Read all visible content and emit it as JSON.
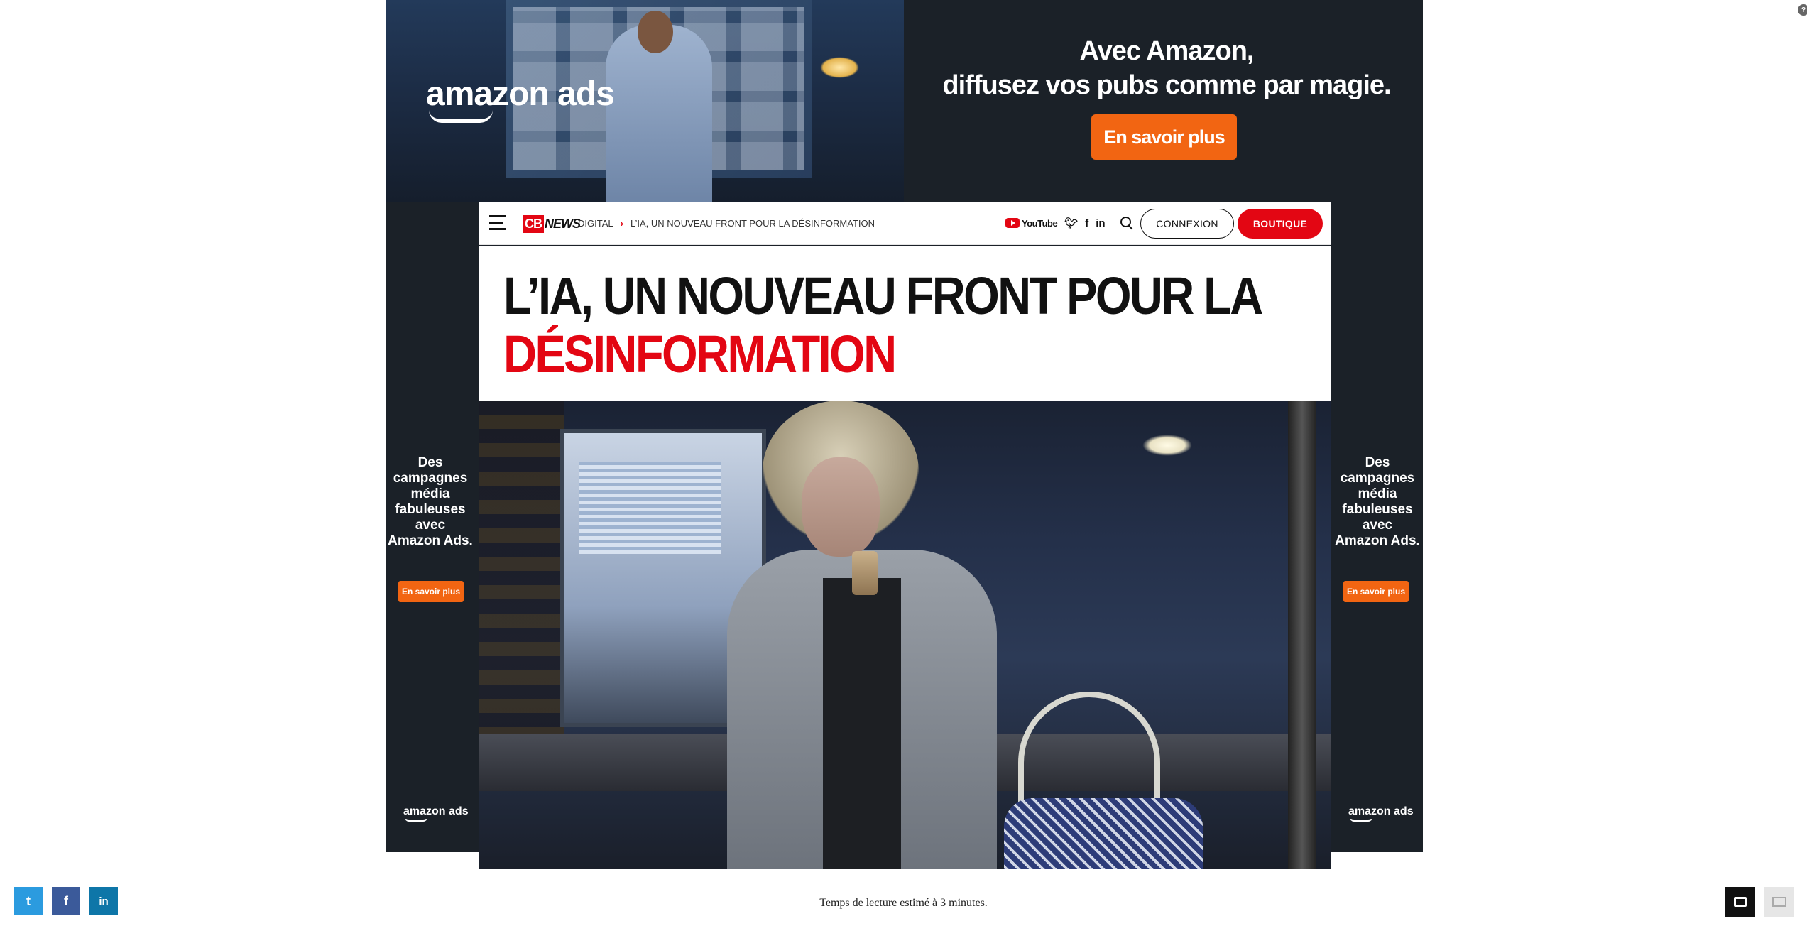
{
  "ad": {
    "brand": "amazon ads",
    "headline_line1": "Avec Amazon,",
    "headline_line2": "diffusez vos  pubs comme par magie.",
    "cta": "En savoir plus",
    "side_text": "Des campagnes média fabuleuses avec Amazon Ads.",
    "side_cta": "En savoir plus",
    "side_brand": "amazon ads",
    "cta_color": "#f26512",
    "background": "#1b2128"
  },
  "header": {
    "logo_cb": "CB",
    "logo_news": "NEWS",
    "breadcrumb": [
      "DIGITAL",
      "L’IA, UN NOUVEAU FRONT POUR LA DÉSINFORMATION"
    ],
    "youtube_label": "YouTube",
    "social_icons": [
      "youtube-icon",
      "twitter-icon",
      "facebook-icon",
      "linkedin-icon",
      "search-icon"
    ],
    "login_label": "CONNEXION",
    "shop_label": "BOUTIQUE",
    "accent": "#e30613"
  },
  "article": {
    "title_line1": "L’IA, UN NOUVEAU FRONT POUR LA",
    "title_line2": "DÉSINFORMATION",
    "hero_alt": "woman at night bus stop looking at phone"
  },
  "footer": {
    "share": [
      {
        "icon": "twitter-icon",
        "glyph": "t",
        "color": "#2b9bdf"
      },
      {
        "icon": "facebook-icon",
        "glyph": "f",
        "color": "#3b5a9a"
      },
      {
        "icon": "linkedin-icon",
        "glyph": "in",
        "color": "#0e76a8"
      }
    ],
    "reading_time": "Temps de lecture estimé à 3 minutes."
  }
}
